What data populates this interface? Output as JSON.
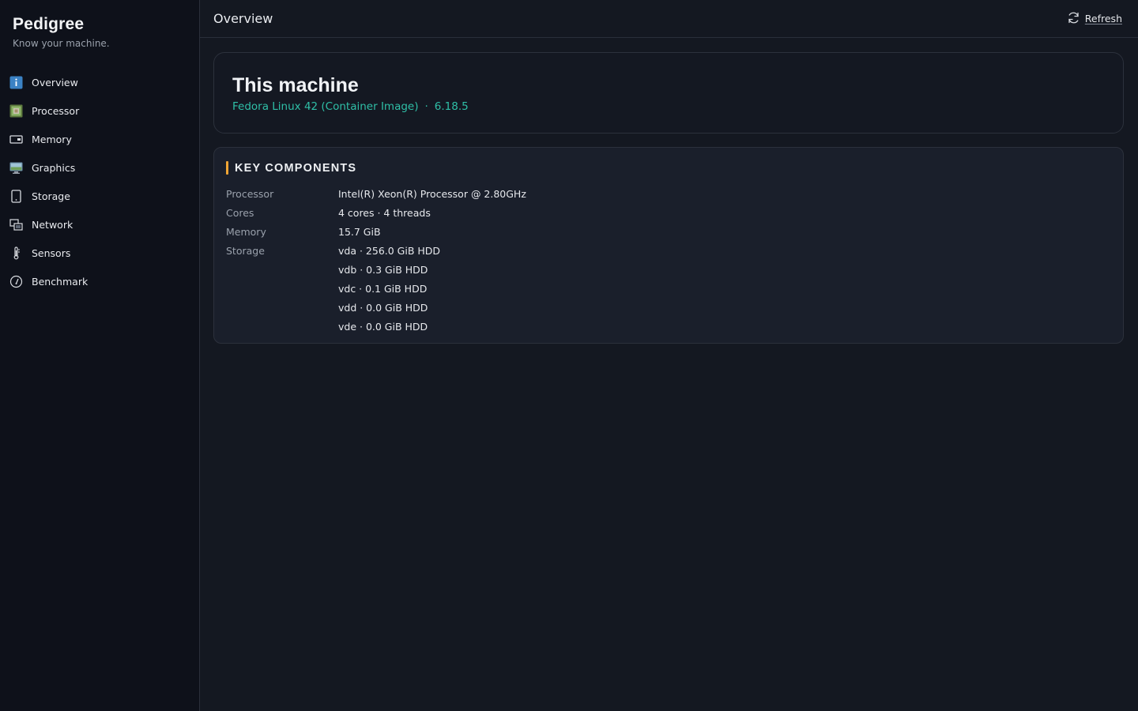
{
  "app": {
    "title": "Pedigree",
    "tagline": "Know your machine."
  },
  "sidebar": {
    "items": [
      {
        "label": "Overview",
        "icon": "info-icon"
      },
      {
        "label": "Processor",
        "icon": "processor-icon"
      },
      {
        "label": "Memory",
        "icon": "memory-icon"
      },
      {
        "label": "Graphics",
        "icon": "monitor-icon"
      },
      {
        "label": "Storage",
        "icon": "storage-icon"
      },
      {
        "label": "Network",
        "icon": "network-icon"
      },
      {
        "label": "Sensors",
        "icon": "thermometer-icon"
      },
      {
        "label": "Benchmark",
        "icon": "gauge-icon"
      }
    ],
    "active": "Overview"
  },
  "header": {
    "title": "Overview",
    "refresh_label": "Refresh",
    "refresh_icon": "refresh-icon"
  },
  "machine": {
    "title": "This machine",
    "os": "Fedora Linux 42 (Container Image)",
    "separator": "·",
    "kernel": "6.18.5"
  },
  "components": {
    "heading": "KEY COMPONENTS",
    "rows": [
      {
        "key": "Processor",
        "value": "Intel(R) Xeon(R) Processor @ 2.80GHz"
      },
      {
        "key": "Cores",
        "value": "4 cores · 4 threads"
      },
      {
        "key": "Memory",
        "value": "15.7 GiB"
      },
      {
        "key": "Storage",
        "value": "vda · 256.0 GiB HDD"
      },
      {
        "key": "",
        "value": "vdb · 0.3 GiB HDD"
      },
      {
        "key": "",
        "value": "vdc · 0.1 GiB HDD"
      },
      {
        "key": "",
        "value": "vdd · 0.0 GiB HDD"
      },
      {
        "key": "",
        "value": "vde · 0.0 GiB HDD"
      }
    ]
  },
  "colors": {
    "accent": "#f0a534",
    "link_teal": "#2fbfa7",
    "sidebar_bg": "#0e111a",
    "main_bg": "#141821",
    "card_bg": "#1a1f2b"
  }
}
